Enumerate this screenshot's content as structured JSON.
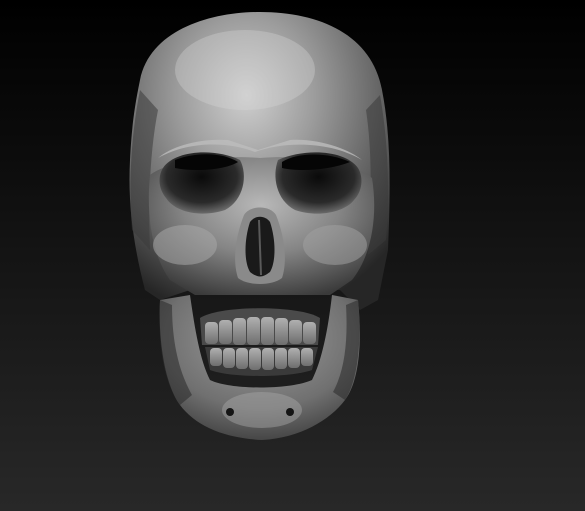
{
  "scene": {
    "subject": "skull-sculpt",
    "background_top": "#000000",
    "background_bottom": "#282828",
    "material_highlight": "#c8c8c8",
    "material_mid": "#8a8a8a",
    "material_shadow": "#2a2a2a"
  }
}
